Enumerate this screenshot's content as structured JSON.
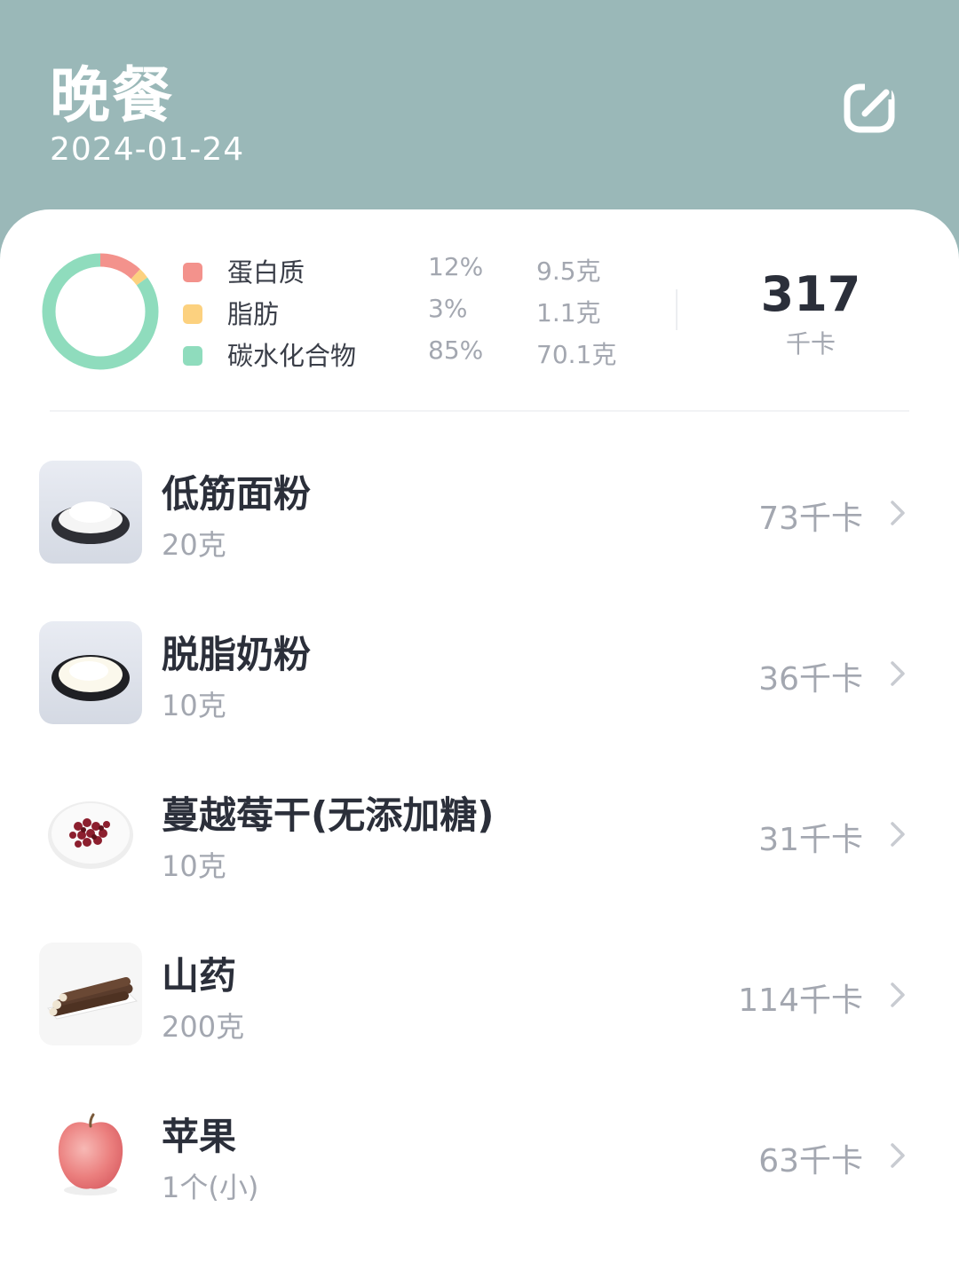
{
  "header": {
    "title": "晚餐",
    "date": "2024-01-24",
    "edit_icon": "edit-icon"
  },
  "colors": {
    "header_bg": "#9ab8b8",
    "protein": "#f3928c",
    "fat": "#fcd17f",
    "carbs": "#8fdcbd",
    "muted_text": "#a3a7b0"
  },
  "summary": {
    "macros": [
      {
        "name": "蛋白质",
        "percent": "12%",
        "grams": "9.5克",
        "share": 0.12,
        "color": "#f3928c"
      },
      {
        "name": "脂肪",
        "percent": "3%",
        "grams": "1.1克",
        "share": 0.03,
        "color": "#fcd17f"
      },
      {
        "name": "碳水化合物",
        "percent": "85%",
        "grams": "70.1克",
        "share": 0.85,
        "color": "#8fdcbd"
      }
    ],
    "total_kcal": "317",
    "kcal_unit": "千卡"
  },
  "foods": [
    {
      "name": "低筋面粉",
      "quantity": "20克",
      "kcal": "73千卡",
      "image": "flour-plate"
    },
    {
      "name": "脱脂奶粉",
      "quantity": "10克",
      "kcal": "36千卡",
      "image": "milk-powder-plate"
    },
    {
      "name": "蔓越莓干(无添加糖)",
      "quantity": "10克",
      "kcal": "31千卡",
      "image": "dried-cranberry-plate"
    },
    {
      "name": "山药",
      "quantity": "200克",
      "kcal": "114千卡",
      "image": "yam-sticks"
    },
    {
      "name": "苹果",
      "quantity": "1个(小)",
      "kcal": "63千卡",
      "image": "apple"
    }
  ]
}
